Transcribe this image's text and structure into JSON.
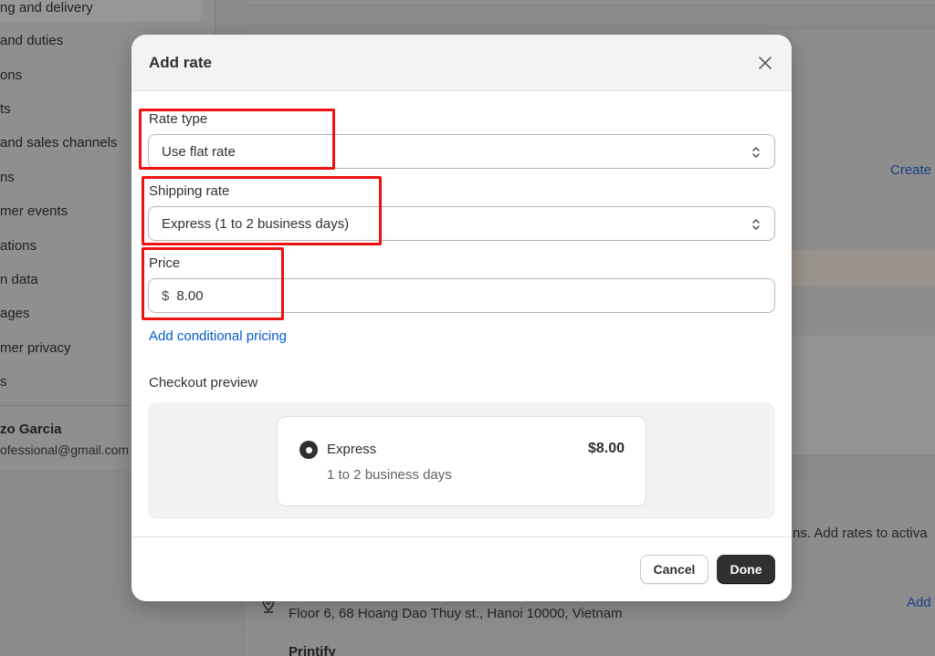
{
  "background": {
    "sidebar": {
      "items": [
        "ng and delivery",
        "and duties",
        "ons",
        "ts",
        "and sales channels",
        "ns",
        "mer events",
        "ations",
        "n data",
        "ages",
        "mer privacy",
        "s"
      ],
      "user_name": "zo Garcia",
      "user_email": "ofessional@gmail.com"
    },
    "create_link": "Create",
    "notice_text": "ns. Add rates to activa",
    "address": "Floor 6, 68 Hoang Dao Thuy st., Hanoi 10000, Vietnam",
    "add_link": "Add",
    "printify": "Printify"
  },
  "modal": {
    "title": "Add rate",
    "rate_type": {
      "label": "Rate type",
      "value": "Use flat rate"
    },
    "shipping_rate": {
      "label": "Shipping rate",
      "value": "Express (1 to 2 business days)"
    },
    "price": {
      "label": "Price",
      "prefix": "$",
      "value": "8.00"
    },
    "conditional_pricing_link": "Add conditional pricing",
    "checkout_preview": {
      "title": "Checkout preview",
      "option_name": "Express",
      "option_price": "$8.00",
      "option_detail": "1 to 2 business days"
    },
    "buttons": {
      "cancel": "Cancel",
      "done": "Done"
    }
  },
  "colors": {
    "annotation": "#ee1111",
    "link": "#005bd3",
    "primary_button": "#303030",
    "overlay": "#8a8a8a"
  },
  "icons": {
    "close": "close-icon",
    "select": "chevron-up-down-icon",
    "location": "location-pin-icon"
  }
}
